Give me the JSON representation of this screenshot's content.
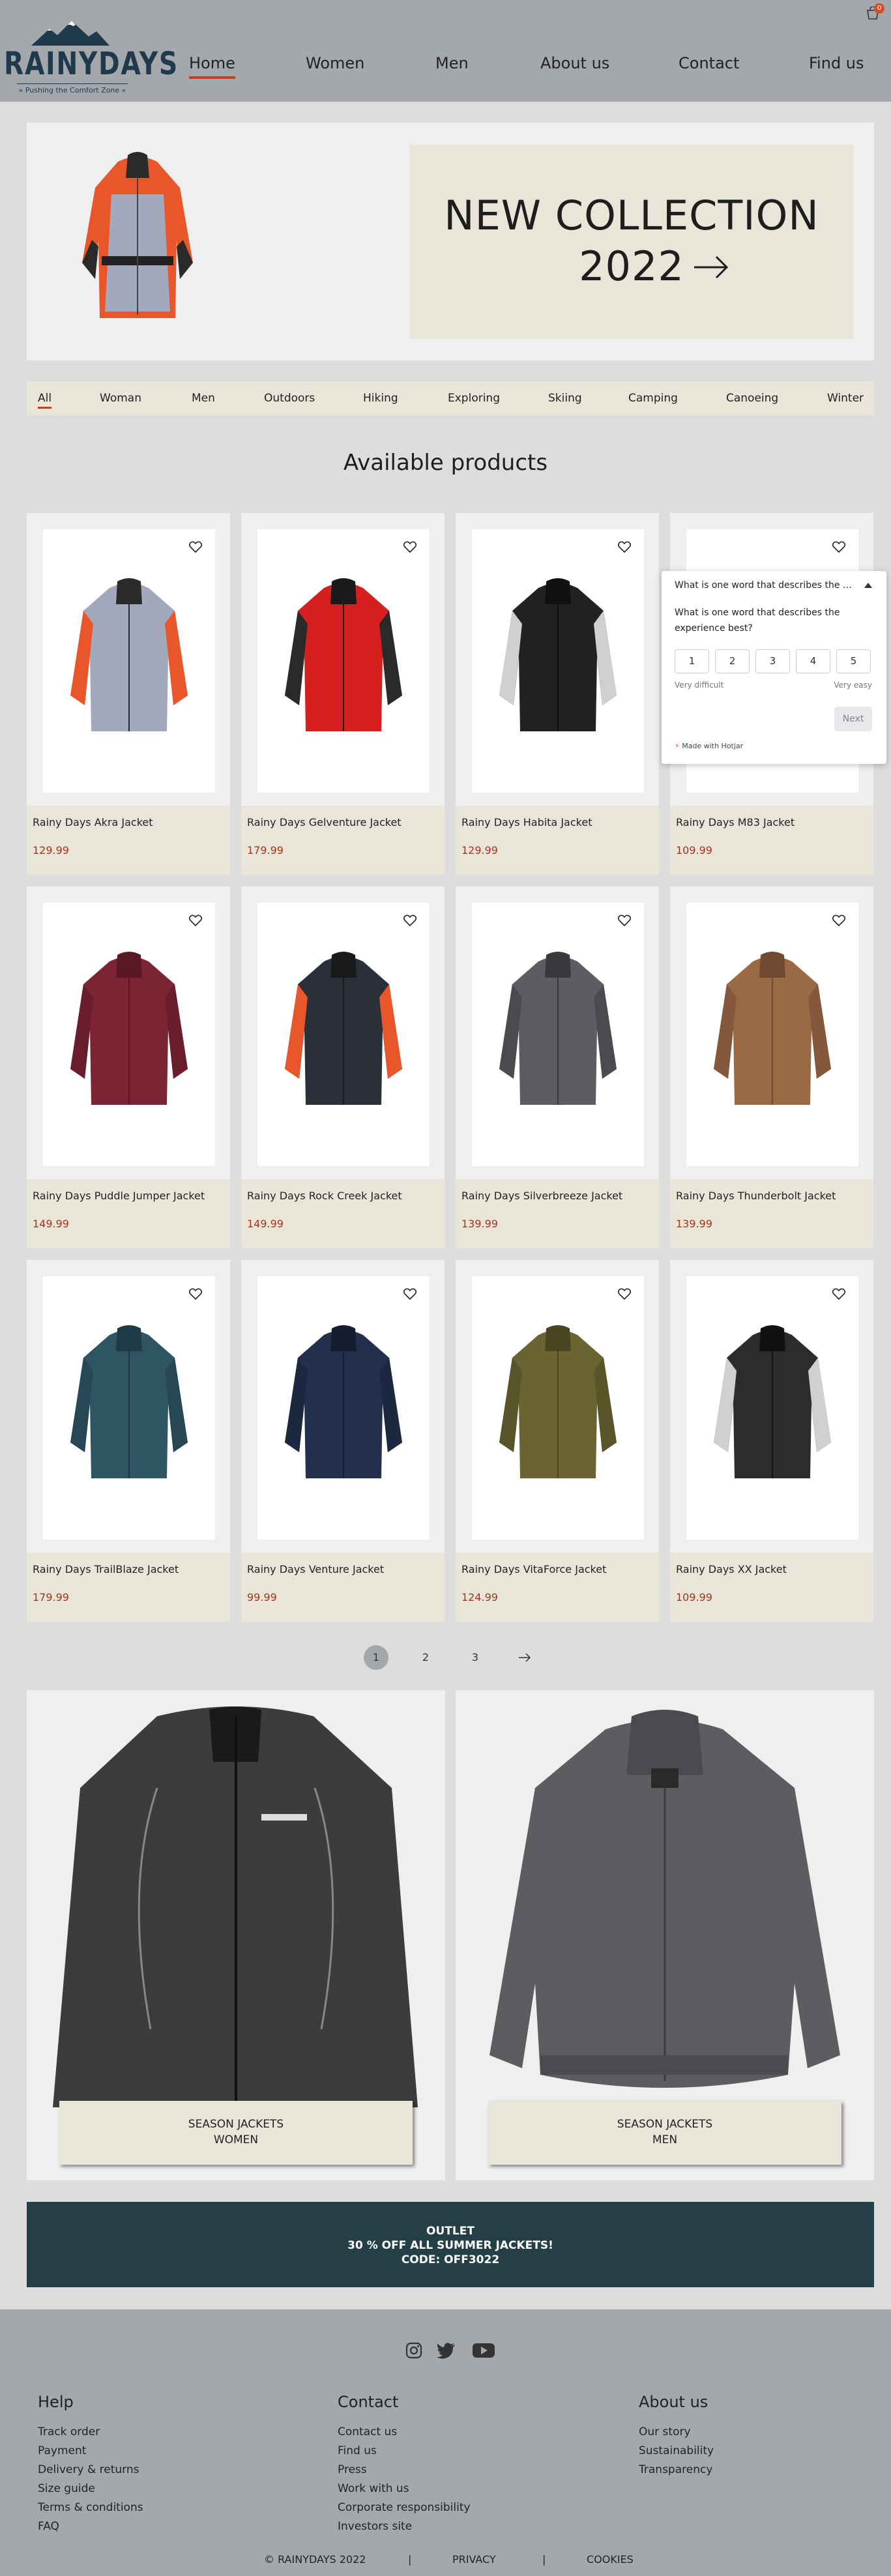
{
  "brand": {
    "name": "RAINYDAYS",
    "tagline": "» Pushing the Comfort Zone «"
  },
  "cart": {
    "count": "0"
  },
  "nav": [
    {
      "label": "Home",
      "active": true
    },
    {
      "label": "Women"
    },
    {
      "label": "Men"
    },
    {
      "label": "About us"
    },
    {
      "label": "Contact"
    },
    {
      "label": "Find us"
    }
  ],
  "hero": {
    "line1": "NEW COLLECTION",
    "line2": "2022"
  },
  "categories": [
    "All",
    "Woman",
    "Men",
    "Outdoors",
    "Hiking",
    "Exploring",
    "Skiing",
    "Camping",
    "Canoeing",
    "Winter"
  ],
  "section_title": "Available products",
  "products": [
    {
      "name": "Rainy Days Akra Jacket",
      "price": "129.99"
    },
    {
      "name": "Rainy Days Gelventure Jacket",
      "price": "179.99"
    },
    {
      "name": "Rainy Days Habita Jacket",
      "price": "129.99"
    },
    {
      "name": "Rainy Days M83 Jacket",
      "price": "109.99"
    },
    {
      "name": "Rainy Days Puddle Jumper Jacket",
      "price": "149.99"
    },
    {
      "name": "Rainy Days Rock Creek Jacket",
      "price": "149.99"
    },
    {
      "name": "Rainy Days Silverbreeze Jacket",
      "price": "139.99"
    },
    {
      "name": "Rainy Days Thunderbolt Jacket",
      "price": "139.99"
    },
    {
      "name": "Rainy Days TrailBlaze Jacket",
      "price": "179.99"
    },
    {
      "name": "Rainy Days Venture Jacket",
      "price": "99.99"
    },
    {
      "name": "Rainy Days VitaForce Jacket",
      "price": "124.99"
    },
    {
      "name": "Rainy Days XX Jacket",
      "price": "109.99"
    }
  ],
  "survey": {
    "header": "What is one word that describes the experience best?",
    "question": "What is one word that describes the experience best?",
    "scale": [
      "1",
      "2",
      "3",
      "4",
      "5"
    ],
    "low_label": "Very difficult",
    "high_label": "Very easy",
    "next": "Next",
    "made_with": "Made with Hotjar"
  },
  "pagination": [
    "1",
    "2",
    "3"
  ],
  "season": [
    {
      "line1": "SEASON JACKETS",
      "line2": "WOMEN"
    },
    {
      "line1": "SEASON JACKETS",
      "line2": "MEN"
    }
  ],
  "outlet": {
    "line1": "OUTLET",
    "line2": "30 % OFF ALL SUMMER JACKETS!",
    "line3": "CODE: OFF3022"
  },
  "footer": {
    "help": {
      "title": "Help",
      "links": [
        "Track order",
        "Payment",
        "Delivery & returns",
        "Size guide",
        "Terms & conditions",
        "FAQ"
      ]
    },
    "contact": {
      "title": "Contact",
      "links": [
        "Contact us",
        "Find us",
        "Press",
        "Work with us",
        "Corporate responsibility",
        "Investors site"
      ]
    },
    "about": {
      "title": "About us",
      "links": [
        "Our story",
        "Sustainability",
        "Transparency"
      ]
    },
    "copyright": "© RAINYDAYS 2022",
    "privacy": "PRIVACY",
    "cookies": "COOKIES",
    "separator": "|"
  },
  "colors": {
    "accent": "#c2401f",
    "header_bg": "#a4a8ac",
    "beige": "#e9e6d9",
    "outlet_bg": "#243f45",
    "price": "#a8321a"
  }
}
